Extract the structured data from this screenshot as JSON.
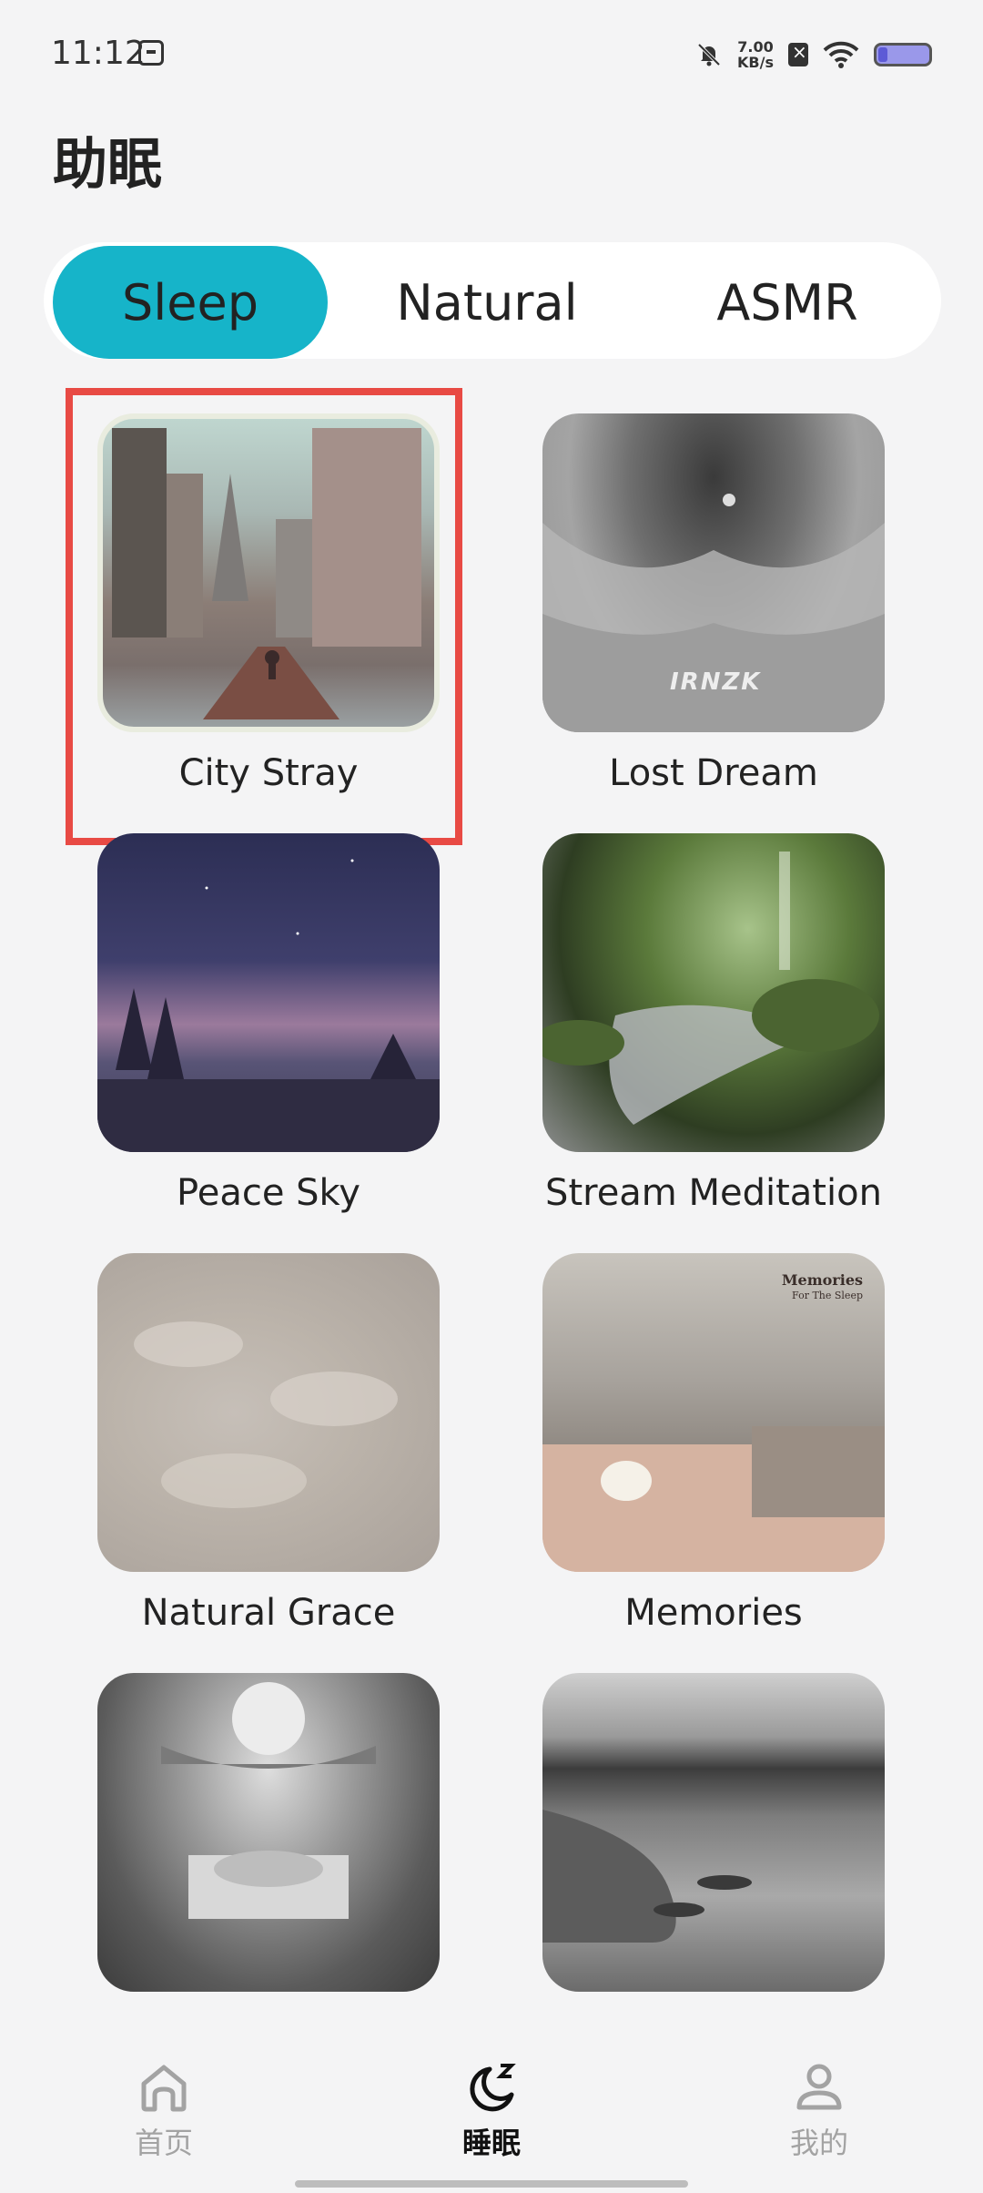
{
  "status_bar": {
    "time": "11:12",
    "net_speed_value": "7.00",
    "net_speed_unit": "KB/s"
  },
  "page": {
    "title": "助眠"
  },
  "tabs": [
    {
      "label": "Sleep",
      "active": true
    },
    {
      "label": "Natural",
      "active": false
    },
    {
      "label": "ASMR",
      "active": false
    }
  ],
  "sounds": [
    {
      "title": "City Stray"
    },
    {
      "title": "Lost Dream"
    },
    {
      "title": "Peace Sky"
    },
    {
      "title": "Stream Meditation"
    },
    {
      "title": "Natural Grace"
    },
    {
      "title": "Memories"
    },
    {
      "title": ""
    },
    {
      "title": ""
    }
  ],
  "thumb_text": {
    "lost_dream": "IRNZK",
    "memories_title": "Memories",
    "memories_sub": "For The Sleep"
  },
  "bottom_nav": [
    {
      "label": "首页",
      "icon": "home-icon",
      "active": false
    },
    {
      "label": "睡眠",
      "icon": "moon-zzz-icon",
      "active": true
    },
    {
      "label": "我的",
      "icon": "user-icon",
      "active": false
    }
  ],
  "colors": {
    "accent": "#16b4c9",
    "highlight": "#e84a44",
    "background": "#f4f4f5"
  }
}
